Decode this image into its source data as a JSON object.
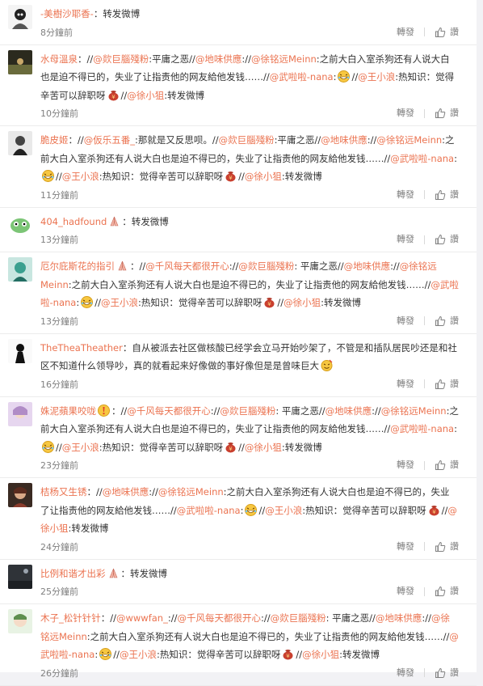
{
  "actions": {
    "forward": "轉發",
    "like": "讚"
  },
  "emoji_names": {
    "laugh": "laugh-cry-emoji",
    "pray": "pray-emoji",
    "money": "money-bag-emoji",
    "bang": "bang-emoji",
    "party": "party-emoji"
  },
  "colors": {
    "username": "#eb7350",
    "text": "#333333",
    "meta": "#808080"
  },
  "comments": [
    {
      "user": "-美樹沙耶香-",
      "avatar": "a1",
      "time": "8分鐘前",
      "parts": [
        {
          "t": "txt",
          "v": "：转发微博"
        }
      ]
    },
    {
      "user": "水母溫泉",
      "avatar": "a2",
      "time": "10分鐘前",
      "parts": [
        {
          "t": "txt",
          "v": "：//"
        },
        {
          "t": "m",
          "v": "@欻巨腦殘粉"
        },
        {
          "t": "txt",
          "v": ":平庸之恶//"
        },
        {
          "t": "m",
          "v": "@地味供應"
        },
        {
          "t": "txt",
          "v": "://"
        },
        {
          "t": "m",
          "v": "@徐铭远Meinn"
        },
        {
          "t": "txt",
          "v": ":之前大白入室杀狗还有人说大白也是迫不得已的，失业了让指责他的网友給他发钱……//"
        },
        {
          "t": "m",
          "v": "@武啦啦-nana"
        },
        {
          "t": "txt",
          "v": ":"
        },
        {
          "t": "e",
          "v": "laugh"
        },
        {
          "t": "txt",
          "v": "//"
        },
        {
          "t": "m",
          "v": "@王小浪"
        },
        {
          "t": "txt",
          "v": ":热知识：觉得辛苦可以辞职呀"
        },
        {
          "t": "e",
          "v": "money"
        },
        {
          "t": "txt",
          "v": "//"
        },
        {
          "t": "m",
          "v": "@徐小狙"
        },
        {
          "t": "txt",
          "v": ":转发微博"
        }
      ]
    },
    {
      "user": "脆皮姬",
      "avatar": "a3",
      "time": "11分鐘前",
      "parts": [
        {
          "t": "txt",
          "v": "：//"
        },
        {
          "t": "m",
          "v": "@仮乐五番_"
        },
        {
          "t": "txt",
          "v": ":那就是又反思呗。//"
        },
        {
          "t": "m",
          "v": "@欻巨腦殘粉"
        },
        {
          "t": "txt",
          "v": ":平庸之恶//"
        },
        {
          "t": "m",
          "v": "@地味供應"
        },
        {
          "t": "txt",
          "v": "://"
        },
        {
          "t": "m",
          "v": "@徐铭远Meinn"
        },
        {
          "t": "txt",
          "v": ":之前大白入室杀狗还有人说大白也是迫不得已的，失业了让指责他的网友給他发钱……//"
        },
        {
          "t": "m",
          "v": "@武啦啦-nana"
        },
        {
          "t": "txt",
          "v": ":"
        },
        {
          "t": "e",
          "v": "laugh"
        },
        {
          "t": "txt",
          "v": "//"
        },
        {
          "t": "m",
          "v": "@王小浪"
        },
        {
          "t": "txt",
          "v": ":热知识：觉得辛苦可以辞职呀"
        },
        {
          "t": "e",
          "v": "money"
        },
        {
          "t": "txt",
          "v": "//"
        },
        {
          "t": "m",
          "v": "@徐小狙"
        },
        {
          "t": "txt",
          "v": ":转发微博"
        }
      ]
    },
    {
      "user": "404_hadfound",
      "avatar": "a4",
      "time": "13分鐘前",
      "parts": [
        {
          "t": "e",
          "v": "pray"
        },
        {
          "t": "txt",
          "v": "：转发微博"
        }
      ]
    },
    {
      "user": "厄尔庇斯花的指引",
      "avatar": "a5",
      "time": "13分鐘前",
      "parts": [
        {
          "t": "e",
          "v": "pray"
        },
        {
          "t": "txt",
          "v": "：//"
        },
        {
          "t": "m",
          "v": "@千风每天都很开心"
        },
        {
          "t": "txt",
          "v": "://"
        },
        {
          "t": "m",
          "v": "@欻巨腦殘粉"
        },
        {
          "t": "txt",
          "v": ": 平庸之恶//"
        },
        {
          "t": "m",
          "v": "@地味供應"
        },
        {
          "t": "txt",
          "v": "://"
        },
        {
          "t": "m",
          "v": "@徐铭远Meinn"
        },
        {
          "t": "txt",
          "v": ":之前大白入室杀狗还有人说大白也是迫不得已的，失业了让指责他的网友給他发钱……//"
        },
        {
          "t": "m",
          "v": "@武啦啦-nana"
        },
        {
          "t": "txt",
          "v": ":"
        },
        {
          "t": "e",
          "v": "laugh"
        },
        {
          "t": "txt",
          "v": "//"
        },
        {
          "t": "m",
          "v": "@王小浪"
        },
        {
          "t": "txt",
          "v": ":热知识：觉得辛苦可以辞职呀"
        },
        {
          "t": "e",
          "v": "money"
        },
        {
          "t": "txt",
          "v": "//"
        },
        {
          "t": "m",
          "v": "@徐小狙"
        },
        {
          "t": "txt",
          "v": ":转发微博"
        }
      ]
    },
    {
      "user": "TheTheaTheather",
      "avatar": "a6",
      "time": "16分鐘前",
      "parts": [
        {
          "t": "txt",
          "v": "：自从被派去社区做核酸已经学会立马开始吵架了，不管是和插队居民吵还是和社区不知道什么领导吵，真的就看起来好像做的事好像但是是曾味巨大"
        },
        {
          "t": "e",
          "v": "party"
        }
      ]
    },
    {
      "user": "姝泥蘋果咬咙",
      "avatar": "a7",
      "time": "23分鐘前",
      "parts": [
        {
          "t": "e",
          "v": "bang"
        },
        {
          "t": "txt",
          "v": "：//"
        },
        {
          "t": "m",
          "v": "@千风每天都很开心"
        },
        {
          "t": "txt",
          "v": "://"
        },
        {
          "t": "m",
          "v": "@欻巨腦殘粉"
        },
        {
          "t": "txt",
          "v": ": 平庸之恶//"
        },
        {
          "t": "m",
          "v": "@地味供應"
        },
        {
          "t": "txt",
          "v": "://"
        },
        {
          "t": "m",
          "v": "@徐铭远Meinn"
        },
        {
          "t": "txt",
          "v": ":之前大白入室杀狗还有人说大白也是迫不得已的，失业了让指责他的网友給他发钱……//"
        },
        {
          "t": "m",
          "v": "@武啦啦-nana"
        },
        {
          "t": "txt",
          "v": ":"
        },
        {
          "t": "e",
          "v": "laugh"
        },
        {
          "t": "txt",
          "v": "//"
        },
        {
          "t": "m",
          "v": "@王小浪"
        },
        {
          "t": "txt",
          "v": ":热知识：觉得辛苦可以辞职呀"
        },
        {
          "t": "e",
          "v": "money"
        },
        {
          "t": "txt",
          "v": "//"
        },
        {
          "t": "m",
          "v": "@徐小狙"
        },
        {
          "t": "txt",
          "v": ":转发微博"
        }
      ]
    },
    {
      "user": "桔杨又生锈",
      "avatar": "a8",
      "time": "24分鐘前",
      "parts": [
        {
          "t": "txt",
          "v": "：//"
        },
        {
          "t": "m",
          "v": "@地味供應"
        },
        {
          "t": "txt",
          "v": "://"
        },
        {
          "t": "m",
          "v": "@徐铭远Meinn"
        },
        {
          "t": "txt",
          "v": ":之前大白入室杀狗还有人说大白也是迫不得已的，失业了让指责他的网友給他发钱……//"
        },
        {
          "t": "m",
          "v": "@武啦啦-nana"
        },
        {
          "t": "txt",
          "v": ":"
        },
        {
          "t": "e",
          "v": "laugh"
        },
        {
          "t": "txt",
          "v": "//"
        },
        {
          "t": "m",
          "v": "@王小浪"
        },
        {
          "t": "txt",
          "v": ":热知识：觉得辛苦可以辞职呀"
        },
        {
          "t": "e",
          "v": "money"
        },
        {
          "t": "txt",
          "v": "//"
        },
        {
          "t": "m",
          "v": "@徐小狙"
        },
        {
          "t": "txt",
          "v": ":转发微博"
        }
      ]
    },
    {
      "user": "比例和谐才出彩",
      "avatar": "a9",
      "time": "25分鐘前",
      "parts": [
        {
          "t": "e",
          "v": "pray"
        },
        {
          "t": "txt",
          "v": "：转发微博"
        }
      ]
    },
    {
      "user": "木子_松针针针",
      "avatar": "a10",
      "time": "26分鐘前",
      "parts": [
        {
          "t": "txt",
          "v": "：//"
        },
        {
          "t": "m",
          "v": "@wwwfan_"
        },
        {
          "t": "txt",
          "v": "://"
        },
        {
          "t": "m",
          "v": "@千风每天都很开心"
        },
        {
          "t": "txt",
          "v": "://"
        },
        {
          "t": "m",
          "v": "@欻巨腦殘粉"
        },
        {
          "t": "txt",
          "v": ": 平庸之恶//"
        },
        {
          "t": "m",
          "v": "@地味供應"
        },
        {
          "t": "txt",
          "v": "://"
        },
        {
          "t": "m",
          "v": "@徐铭远Meinn"
        },
        {
          "t": "txt",
          "v": ":之前大白入室杀狗还有人说大白也是迫不得已的，失业了让指责他的网友給他发钱……//"
        },
        {
          "t": "m",
          "v": "@武啦啦-nana"
        },
        {
          "t": "txt",
          "v": ":"
        },
        {
          "t": "e",
          "v": "laugh"
        },
        {
          "t": "txt",
          "v": "//"
        },
        {
          "t": "m",
          "v": "@王小浪"
        },
        {
          "t": "txt",
          "v": ":热知识：觉得辛苦可以辞职呀"
        },
        {
          "t": "e",
          "v": "money"
        },
        {
          "t": "txt",
          "v": "//"
        },
        {
          "t": "m",
          "v": "@徐小狙"
        },
        {
          "t": "txt",
          "v": ":转发微博"
        }
      ]
    }
  ]
}
